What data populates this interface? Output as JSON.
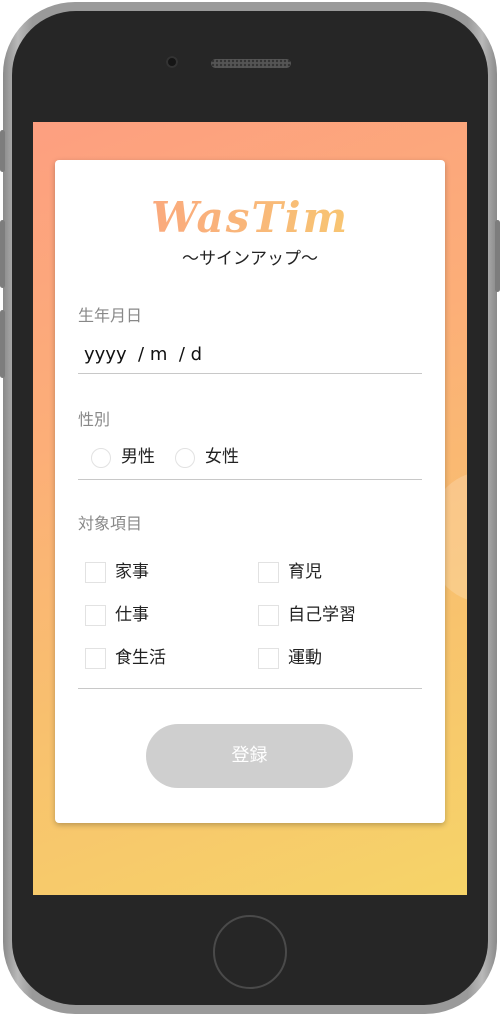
{
  "app": {
    "logo": "WasTim",
    "subtitle": "～サインアップ～"
  },
  "birthdate": {
    "label": "生年月日",
    "placeholder": "yyyy  / m  / d"
  },
  "gender": {
    "label": "性別",
    "options": [
      "男性",
      "女性"
    ]
  },
  "targets": {
    "label": "対象項目",
    "items": [
      "家事",
      "育児",
      "仕事",
      "自己学習",
      "食生活",
      "運動"
    ]
  },
  "submit": {
    "label": "登録"
  },
  "colors": {
    "gradient_start": "#fd9f80",
    "gradient_end": "#f6d468",
    "button_disabled": "#cfcfcf"
  }
}
